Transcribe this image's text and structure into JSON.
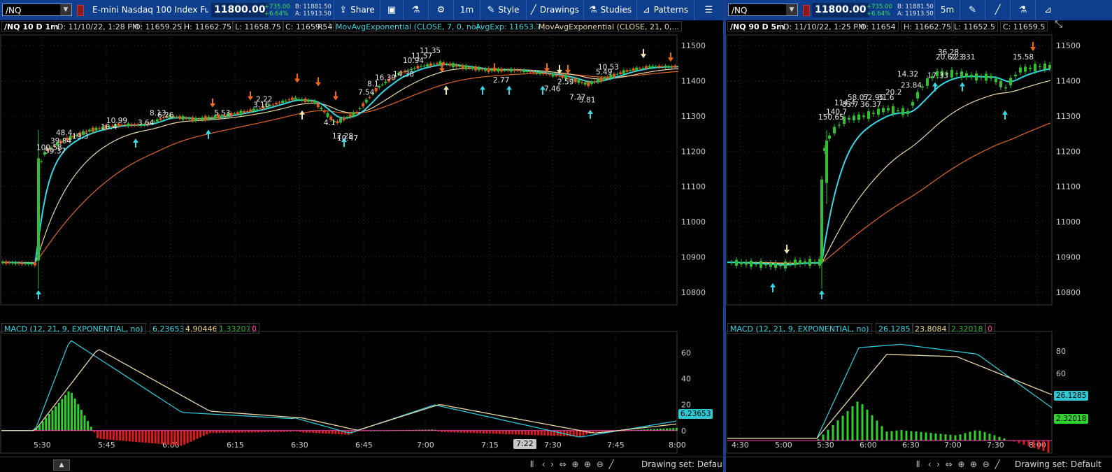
{
  "left": {
    "symbol": "/NQ",
    "description": "E-mini Nasdaq 100 Index Fut...",
    "last_price": "11800.00",
    "net_change": "+735.00",
    "pct_change": "+6.64%",
    "bid": "B: 11881.50",
    "ask": "A: 11913.50",
    "toolbar": {
      "share": "Share",
      "timeframe": "1m",
      "style": "Style",
      "drawings": "Drawings",
      "studies": "Studies",
      "patterns": "Patterns"
    },
    "info": {
      "title": "/NQ 10 D 1m",
      "date": "D: 11/10/22, 1:28 PM",
      "open": "O: 11659.25",
      "high": "H: 11662.75",
      "low": "L: 11658.75",
      "close": "C: 11659.5",
      "range": "R: 4",
      "study1": "MovAvgExponential (CLOSE, 7, 0, no)",
      "study1_value": "AvgExp: 11653.7",
      "study2": "MovAvgExponential (CLOSE, 21, 0,..."
    },
    "price_axis": [
      "11500",
      "11400",
      "11300",
      "11200",
      "11100",
      "11000",
      "10900",
      "10800"
    ],
    "macd": {
      "label": "MACD (12, 21, 9, EXPONENTIAL, no)",
      "value": "6.23653",
      "avg": "4.90446",
      "diff": "1.33207",
      "zero": "0",
      "axis": [
        "60",
        "40",
        "20",
        "0"
      ],
      "tag": "6.23653"
    },
    "time_axis": [
      "5:30",
      "5:45",
      "6:00",
      "6:15",
      "6:30",
      "6:45",
      "7:00",
      "7:15",
      "7:30",
      "7:45",
      "8:00"
    ],
    "time_tag": "7:22",
    "bottom": {
      "drawing_set": "Drawing set: Default"
    },
    "candle_labels": [
      "100.58",
      "59.37",
      "48.4",
      "39.84",
      "19.3",
      "16.4",
      "10.99",
      "8.13",
      "3.64",
      "6.26",
      "5.53",
      "2.22",
      "3.16",
      "4.1",
      "12.28",
      "10.47",
      "7.54",
      "8.1",
      "16.39",
      "14.38",
      "10.94",
      "11.57",
      "11.35",
      "2.77",
      "7.46",
      "2.59",
      "7.27",
      "5.81",
      "5.49",
      "10.53"
    ]
  },
  "right": {
    "symbol": "/NQ",
    "last_price": "11800.00",
    "net_change": "+735.00",
    "pct_change": "+6.64%",
    "bid": "B: 11881.50",
    "ask": "A: 11913.50",
    "timeframe": "5m",
    "info": {
      "title": "/NQ 90 D 5m",
      "date": "D: 11/10/22, 1:25 PM",
      "open": "O: 11654",
      "high": "H: 11662.75",
      "low": "L: 11652.5",
      "close": "C: 11659.5"
    },
    "price_axis": [
      "11500",
      "11400",
      "11300",
      "11200",
      "11100",
      "11000",
      "10900",
      "10800"
    ],
    "macd": {
      "label": "MACD (12, 21, 9, EXPONENTIAL, no)",
      "value": "26.1285",
      "avg": "23.8084",
      "diff": "2.32018",
      "zero": "0",
      "axis": [
        "80",
        "60",
        "40",
        "20"
      ],
      "tag1": "26.1285",
      "tag2": "2.32018"
    },
    "time_axis": [
      "4:30",
      "5:00",
      "5:30",
      "6:00",
      "6:30",
      "7:00",
      "7:30",
      "8:00"
    ],
    "bottom": {
      "drawing_set": "Drawing set: Default"
    },
    "candle_labels": [
      "150.65",
      "140.7",
      "114.4",
      "83.7",
      "58.07",
      "52.95",
      "36.37",
      "31.6",
      "20.2",
      "14.32",
      "23.84",
      "17.33",
      "36.28",
      "20.62",
      "22.3",
      "3.31",
      "15.58"
    ]
  },
  "colors": {
    "toolbar_bg": "#0d3f8e",
    "ema_fast": "#35d9e6",
    "ema_mid": "#e8d9a8",
    "ema_slow": "#e0652a",
    "macd_line": "#2fc6d4",
    "avg_line": "#e8d9a8",
    "hist_up": "#2fd12f",
    "hist_down": "#e01b1b",
    "zero_line": "#ff3db5",
    "candle_up": "#2fbf2f",
    "candle_down": "#e05a1a",
    "arrow_up": "#35d9e6",
    "arrow_down": "#f06a1a"
  }
}
